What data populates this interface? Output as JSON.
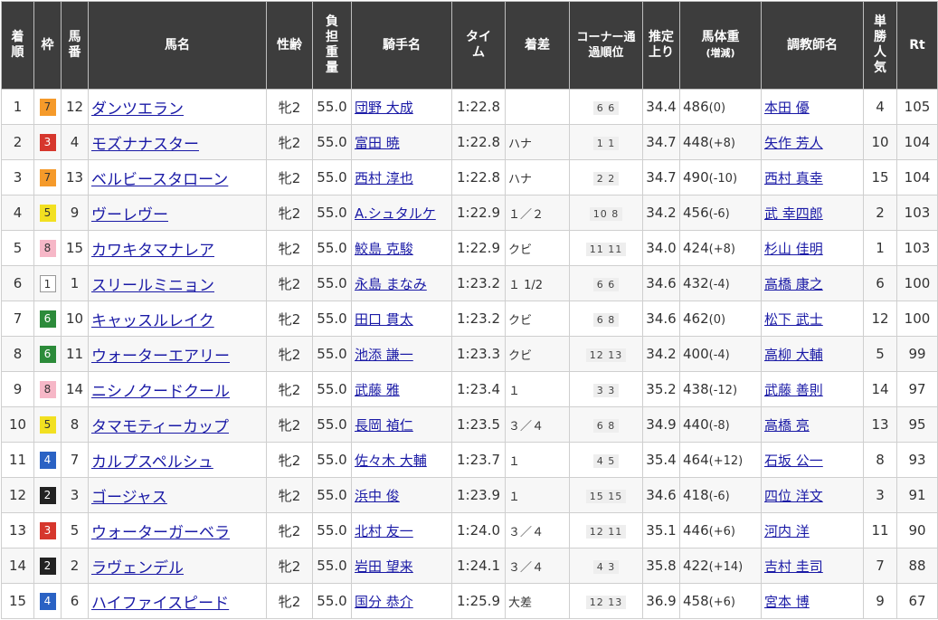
{
  "headers": {
    "pos": "着順",
    "waku": "枠",
    "num": "馬番",
    "name": "馬名",
    "sexage": "性齢",
    "weight": "負担重量",
    "jockey": "騎手名",
    "time": "タイム",
    "margin": "着差",
    "corner": "コーナー通過順位",
    "last3f": "推定上り",
    "bw": "馬体重",
    "bw_sub": "(増減)",
    "trainer": "調教師名",
    "pop": "単勝人気",
    "rt": "Rt"
  },
  "rows": [
    {
      "pos": "1",
      "waku": "7",
      "num": "12",
      "name": "ダンツエラン",
      "sexage": "牝2",
      "weight": "55.0",
      "jockey": "団野 大成",
      "time": "1:22.8",
      "margin": "",
      "corner": "6 6",
      "last3f": "34.4",
      "bw": "486",
      "chg": "(0)",
      "trainer": "本田 優",
      "pop": "4",
      "rt": "105"
    },
    {
      "pos": "2",
      "waku": "3",
      "num": "4",
      "name": "モズナナスター",
      "sexage": "牝2",
      "weight": "55.0",
      "jockey": "富田 暁",
      "time": "1:22.8",
      "margin": "ハナ",
      "corner": "1 1",
      "last3f": "34.7",
      "bw": "448",
      "chg": "(+8)",
      "trainer": "矢作 芳人",
      "pop": "10",
      "rt": "104"
    },
    {
      "pos": "3",
      "waku": "7",
      "num": "13",
      "name": "ベルビースタローン",
      "sexage": "牝2",
      "weight": "55.0",
      "jockey": "西村 淳也",
      "time": "1:22.8",
      "margin": "ハナ",
      "corner": "2 2",
      "last3f": "34.7",
      "bw": "490",
      "chg": "(-10)",
      "trainer": "西村 真幸",
      "pop": "15",
      "rt": "104"
    },
    {
      "pos": "4",
      "waku": "5",
      "num": "9",
      "name": "ヴーレヴー",
      "sexage": "牝2",
      "weight": "55.0",
      "jockey": "A.シュタルケ",
      "time": "1:22.9",
      "margin": "１／２",
      "corner": "10 8",
      "last3f": "34.2",
      "bw": "456",
      "chg": "(-6)",
      "trainer": "武 幸四郎",
      "pop": "2",
      "rt": "103"
    },
    {
      "pos": "5",
      "waku": "8",
      "num": "15",
      "name": "カワキタマナレア",
      "sexage": "牝2",
      "weight": "55.0",
      "jockey": "鮫島 克駿",
      "time": "1:22.9",
      "margin": "クビ",
      "corner": "11 11",
      "last3f": "34.0",
      "bw": "424",
      "chg": "(+8)",
      "trainer": "杉山 佳明",
      "pop": "1",
      "rt": "103"
    },
    {
      "pos": "6",
      "waku": "1",
      "num": "1",
      "name": "スリールミニョン",
      "sexage": "牝2",
      "weight": "55.0",
      "jockey": "永島 まなみ",
      "time": "1:23.2",
      "margin": "１ 1/2",
      "corner": "6 6",
      "last3f": "34.6",
      "bw": "432",
      "chg": "(-4)",
      "trainer": "高橋 康之",
      "pop": "6",
      "rt": "100"
    },
    {
      "pos": "7",
      "waku": "6",
      "num": "10",
      "name": "キャッスルレイク",
      "sexage": "牝2",
      "weight": "55.0",
      "jockey": "田口 貫太",
      "time": "1:23.2",
      "margin": "クビ",
      "corner": "6 8",
      "last3f": "34.6",
      "bw": "462",
      "chg": "(0)",
      "trainer": "松下 武士",
      "pop": "12",
      "rt": "100"
    },
    {
      "pos": "8",
      "waku": "6",
      "num": "11",
      "name": "ウォーターエアリー",
      "sexage": "牝2",
      "weight": "55.0",
      "jockey": "池添 謙一",
      "time": "1:23.3",
      "margin": "クビ",
      "corner": "12 13",
      "last3f": "34.2",
      "bw": "400",
      "chg": "(-4)",
      "trainer": "高柳 大輔",
      "pop": "5",
      "rt": "99"
    },
    {
      "pos": "9",
      "waku": "8",
      "num": "14",
      "name": "ニシノクードクール",
      "sexage": "牝2",
      "weight": "55.0",
      "jockey": "武藤 雅",
      "time": "1:23.4",
      "margin": "１",
      "corner": "3 3",
      "last3f": "35.2",
      "bw": "438",
      "chg": "(-12)",
      "trainer": "武藤 善則",
      "pop": "14",
      "rt": "97"
    },
    {
      "pos": "10",
      "waku": "5",
      "num": "8",
      "name": "タマモティーカップ",
      "sexage": "牝2",
      "weight": "55.0",
      "jockey": "長岡 禎仁",
      "time": "1:23.5",
      "margin": "３／４",
      "corner": "6 8",
      "last3f": "34.9",
      "bw": "440",
      "chg": "(-8)",
      "trainer": "高橋 亮",
      "pop": "13",
      "rt": "95"
    },
    {
      "pos": "11",
      "waku": "4",
      "num": "7",
      "name": "カルプスペルシュ",
      "sexage": "牝2",
      "weight": "55.0",
      "jockey": "佐々木 大輔",
      "time": "1:23.7",
      "margin": "１",
      "corner": "4 5",
      "last3f": "35.4",
      "bw": "464",
      "chg": "(+12)",
      "trainer": "石坂 公一",
      "pop": "8",
      "rt": "93"
    },
    {
      "pos": "12",
      "waku": "2",
      "num": "3",
      "name": "ゴージャス",
      "sexage": "牝2",
      "weight": "55.0",
      "jockey": "浜中 俊",
      "time": "1:23.9",
      "margin": "１",
      "corner": "15 15",
      "last3f": "34.6",
      "bw": "418",
      "chg": "(-6)",
      "trainer": "四位 洋文",
      "pop": "3",
      "rt": "91"
    },
    {
      "pos": "13",
      "waku": "3",
      "num": "5",
      "name": "ウォーターガーベラ",
      "sexage": "牝2",
      "weight": "55.0",
      "jockey": "北村 友一",
      "time": "1:24.0",
      "margin": "３／４",
      "corner": "12 11",
      "last3f": "35.1",
      "bw": "446",
      "chg": "(+6)",
      "trainer": "河内 洋",
      "pop": "11",
      "rt": "90"
    },
    {
      "pos": "14",
      "waku": "2",
      "num": "2",
      "name": "ラヴェンデル",
      "sexage": "牝2",
      "weight": "55.0",
      "jockey": "岩田 望来",
      "time": "1:24.1",
      "margin": "３／４",
      "corner": "4 3",
      "last3f": "35.8",
      "bw": "422",
      "chg": "(+14)",
      "trainer": "吉村 圭司",
      "pop": "7",
      "rt": "88"
    },
    {
      "pos": "15",
      "waku": "4",
      "num": "6",
      "name": "ハイファイスピード",
      "sexage": "牝2",
      "weight": "55.0",
      "jockey": "国分 恭介",
      "time": "1:25.9",
      "margin": "大差",
      "corner": "12 13",
      "last3f": "36.9",
      "bw": "458",
      "chg": "(+6)",
      "trainer": "宮本 博",
      "pop": "9",
      "rt": "67"
    }
  ]
}
